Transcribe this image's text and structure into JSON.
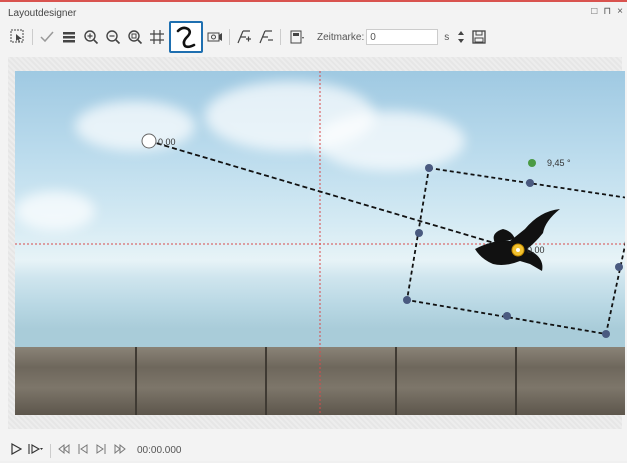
{
  "window": {
    "title": "Layoutdesigner",
    "controls": [
      "□",
      "⊓",
      "×"
    ]
  },
  "toolbar": {
    "zeitmarke_label": "Zeitmarke:",
    "zeitmarke_value": "0",
    "unit": "s"
  },
  "canvas": {
    "start_label": "0,00",
    "end_label": "0,00",
    "rotation_label": "9,45 °"
  },
  "playback": {
    "time": "00:00.000"
  },
  "colors": {
    "accent_border": "#1e6fb0",
    "title_bar_top": "#d9534f",
    "guide_line": "#d84a4a",
    "handle": "#4a5a80",
    "rotate_handle": "#4a9a44"
  }
}
